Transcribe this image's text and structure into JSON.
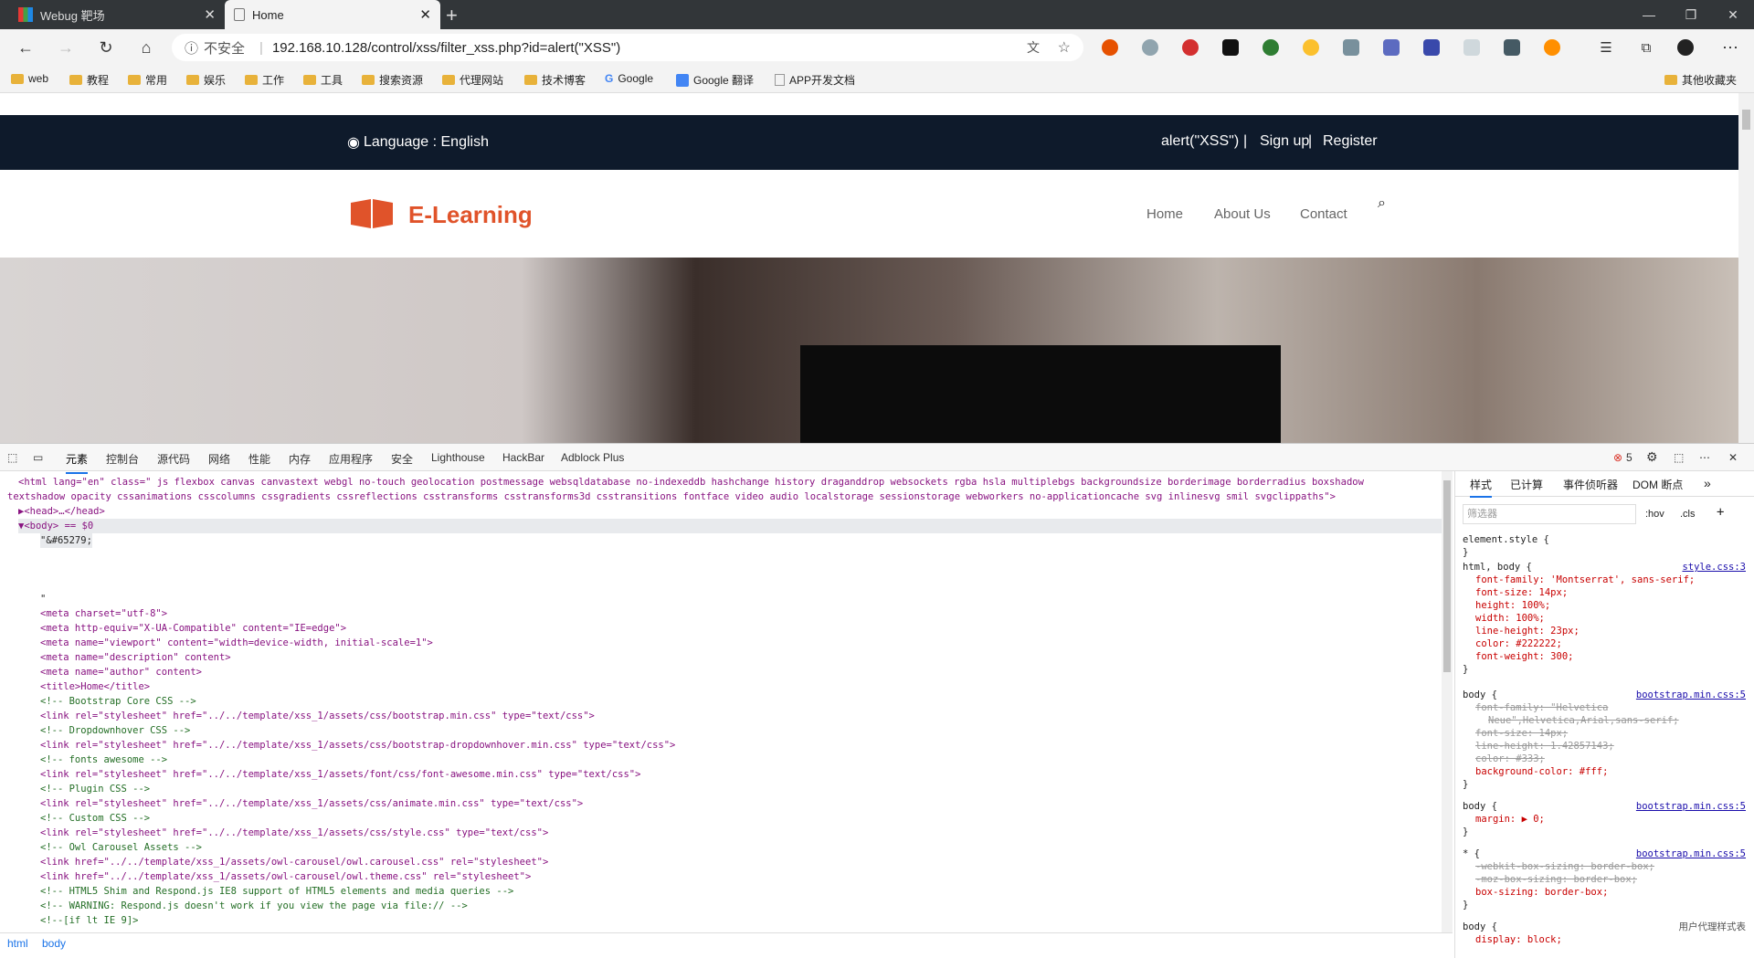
{
  "browser": {
    "tabs": [
      {
        "title": "Webug 靶场"
      },
      {
        "title": "Home"
      }
    ],
    "address": {
      "security": "不安全",
      "url": "192.168.10.128/control/xss/filter_xss.php?id=alert(\"XSS\")"
    },
    "bookmarks": [
      "web",
      "教程",
      "常用",
      "娱乐",
      "工作",
      "工具",
      "搜索资源",
      "代理网站",
      "技术博客",
      "Google",
      "Google 翻译",
      "APP开发文档"
    ],
    "other_bookmarks": "其他收藏夹"
  },
  "site": {
    "language_label": "Language : English",
    "user_text": "alert(\"XSS\")",
    "signup": "Sign up",
    "register": "Register",
    "sep": "|",
    "logo": "E-Learning",
    "nav": [
      "Home",
      "About Us",
      "Contact"
    ]
  },
  "devtools": {
    "tabs": [
      "元素",
      "控制台",
      "源代码",
      "网络",
      "性能",
      "内存",
      "应用程序",
      "安全",
      "Lighthouse",
      "HackBar",
      "Adblock Plus"
    ],
    "error_count": "5",
    "html_line1": "<html lang=\"en\" class=\" js flexbox canvas canvastext webgl no-touch geolocation postmessage websqldatabase no-indexeddb hashchange history draganddrop websockets rgba hsla multiplebgs backgroundsize borderimage borderradius boxshadow",
    "html_line2": "textshadow opacity cssanimations csscolumns cssgradients cssreflections csstransforms csstransforms3d csstransitions fontface video audio localstorage sessionstorage webworkers no-applicationcache svg inlinesvg smil svgclippaths\">",
    "head_line": "▶<head>…</head>",
    "body_line": "▼<body> == $0",
    "text_node": "\"&#65279;",
    "quote_line": "\"",
    "code": [
      "<meta charset=\"utf-8\">",
      "<meta http-equiv=\"X-UA-Compatible\" content=\"IE=edge\">",
      "<meta name=\"viewport\" content=\"width=device-width, initial-scale=1\">",
      "<meta name=\"description\" content>",
      "<meta name=\"author\" content>",
      "<title>Home</title>",
      "<!-- Bootstrap Core CSS -->",
      "<link rel=\"stylesheet\" href=\"../../template/xss_1/assets/css/bootstrap.min.css\" type=\"text/css\">",
      "<!-- Dropdownhover CSS -->",
      "<link rel=\"stylesheet\" href=\"../../template/xss_1/assets/css/bootstrap-dropdownhover.min.css\" type=\"text/css\">",
      "<!-- fonts awesome -->",
      "<link rel=\"stylesheet\" href=\"../../template/xss_1/assets/font/css/font-awesome.min.css\" type=\"text/css\">",
      "<!-- Plugin CSS -->",
      "<link rel=\"stylesheet\" href=\"../../template/xss_1/assets/css/animate.min.css\" type=\"text/css\">",
      "<!-- Custom CSS -->",
      "<link rel=\"stylesheet\" href=\"../../template/xss_1/assets/css/style.css\" type=\"text/css\">",
      "<!-- Owl Carousel Assets -->",
      "<link href=\"../../template/xss_1/assets/owl-carousel/owl.carousel.css\" rel=\"stylesheet\">",
      "<link href=\"../../template/xss_1/assets/owl-carousel/owl.theme.css\" rel=\"stylesheet\">",
      "<!-- HTML5 Shim and Respond.js IE8 support of HTML5 elements and media queries -->",
      "<!-- WARNING: Respond.js doesn't work if you view the page via file:// -->",
      "<!--[if lt IE 9]>"
    ],
    "breadcrumbs": [
      "html",
      "body"
    ],
    "styles_tabs": [
      "样式",
      "已计算",
      "事件侦听器",
      "DOM 断点"
    ],
    "filter_placeholder": "筛选器",
    "hov": ":hov",
    "cls": ".cls",
    "element_style": "element.style {",
    "close_brace": "}",
    "rule1": {
      "selector": "html, body {",
      "source": "style.css:3",
      "props": [
        "font-family: 'Montserrat', sans-serif;",
        "font-size: 14px;",
        "height: 100%;",
        "width: 100%;",
        "line-height: 23px;",
        "color: #222222;",
        "font-weight: 300;"
      ]
    },
    "rule2": {
      "selector": "body {",
      "source": "bootstrap.min.css:5",
      "struck": [
        "font-family: \"Helvetica",
        "Neue\",Helvetica,Arial,sans-serif;",
        "font-size: 14px;",
        "line-height: 1.42857143;",
        "color: #333;"
      ],
      "props": [
        "background-color: #fff;"
      ]
    },
    "rule3": {
      "selector": "body {",
      "source": "bootstrap.min.css:5",
      "props": [
        "margin: ▶ 0;"
      ]
    },
    "rule4": {
      "selector": "* {",
      "source": "bootstrap.min.css:5",
      "struck": [
        "-webkit-box-sizing: border-box;",
        "-moz-box-sizing: border-box;"
      ],
      "props": [
        "box-sizing: border-box;"
      ]
    },
    "rule5": {
      "selector": "body {",
      "source": "用户代理样式表",
      "props": [
        "display: block;"
      ]
    }
  },
  "colors": {
    "topbar": "#0e1a2b",
    "accent": "#e0532a"
  }
}
